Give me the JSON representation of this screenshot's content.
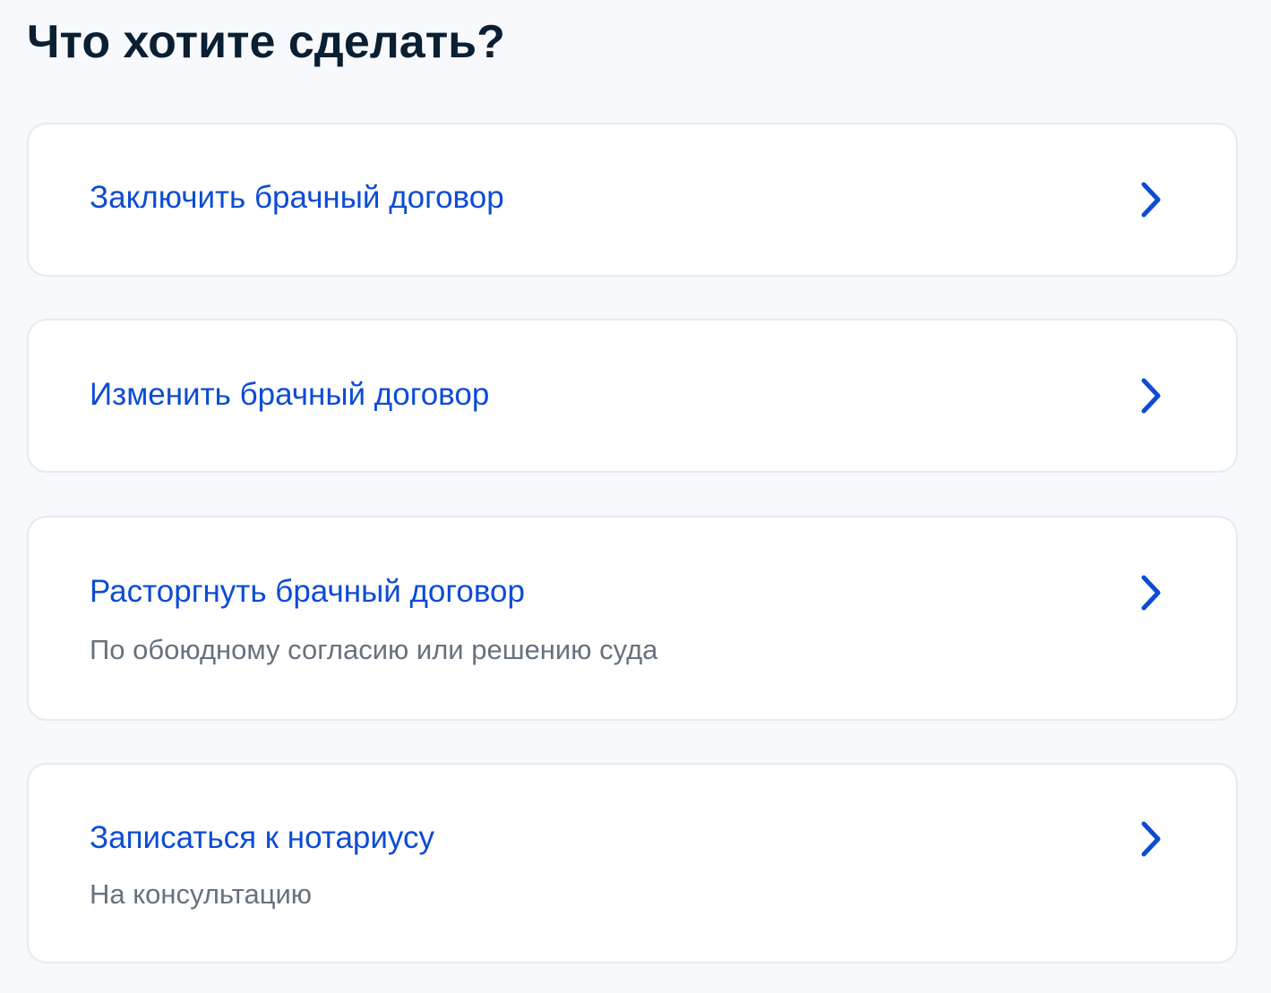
{
  "page": {
    "title": "Что хотите сделать?"
  },
  "options": [
    {
      "title": "Заключить брачный договор",
      "subtitle": ""
    },
    {
      "title": "Изменить брачный договор",
      "subtitle": ""
    },
    {
      "title": "Расторгнуть брачный договор",
      "subtitle": "По обоюдному согласию или решению суда"
    },
    {
      "title": "Записаться к нотариусу",
      "subtitle": "На консультацию"
    }
  ],
  "icons": {
    "option_arrow": "chevron-right-icon"
  },
  "colors": {
    "title": "#0b1f33",
    "link": "#0d4cd3",
    "subtitle": "#66727f",
    "card_border": "#e6ebf2",
    "background": "#f7f9fc"
  }
}
